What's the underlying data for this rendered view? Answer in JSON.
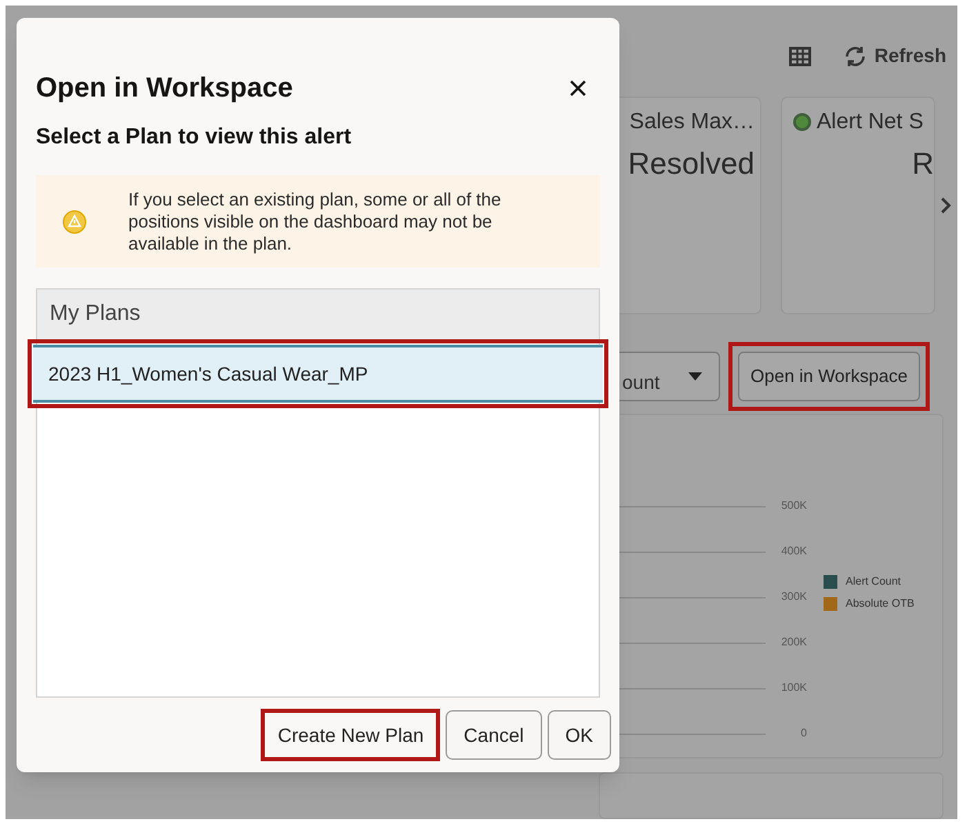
{
  "dialog": {
    "title": "Open in Workspace",
    "subtitle": "Select a Plan to view this alert",
    "notice": "If you select an existing plan, some or all of the positions visible on the dashboard may not be available in the plan.",
    "list_header": "My Plans",
    "plans": [
      {
        "name": "2023 H1_Women's Casual Wear_MP",
        "selected": true,
        "highlighted": true
      }
    ],
    "buttons": [
      {
        "label": "Create New Plan",
        "highlighted": true
      },
      {
        "label": "Cancel",
        "highlighted": false
      },
      {
        "label": "OK",
        "highlighted": false
      }
    ]
  },
  "background": {
    "toolbar": {
      "refresh": "Refresh"
    },
    "cards": [
      {
        "title": "Sales Max…",
        "value": "Resolved",
        "status_dot": false
      },
      {
        "title": "Alert Net S",
        "value": "R",
        "status_dot": true
      }
    ],
    "filter": {
      "value": "ount"
    },
    "open_button": {
      "label": "Open in Workspace",
      "highlighted": true
    },
    "chart": {
      "y_labels": [
        "500K",
        "400K",
        "300K",
        "200K",
        "100K",
        "0"
      ],
      "legend": [
        {
          "name": "Alert Count",
          "color": "#2a4d4e"
        },
        {
          "name": "Absolute OTB",
          "color": "#a1681a"
        }
      ]
    }
  }
}
